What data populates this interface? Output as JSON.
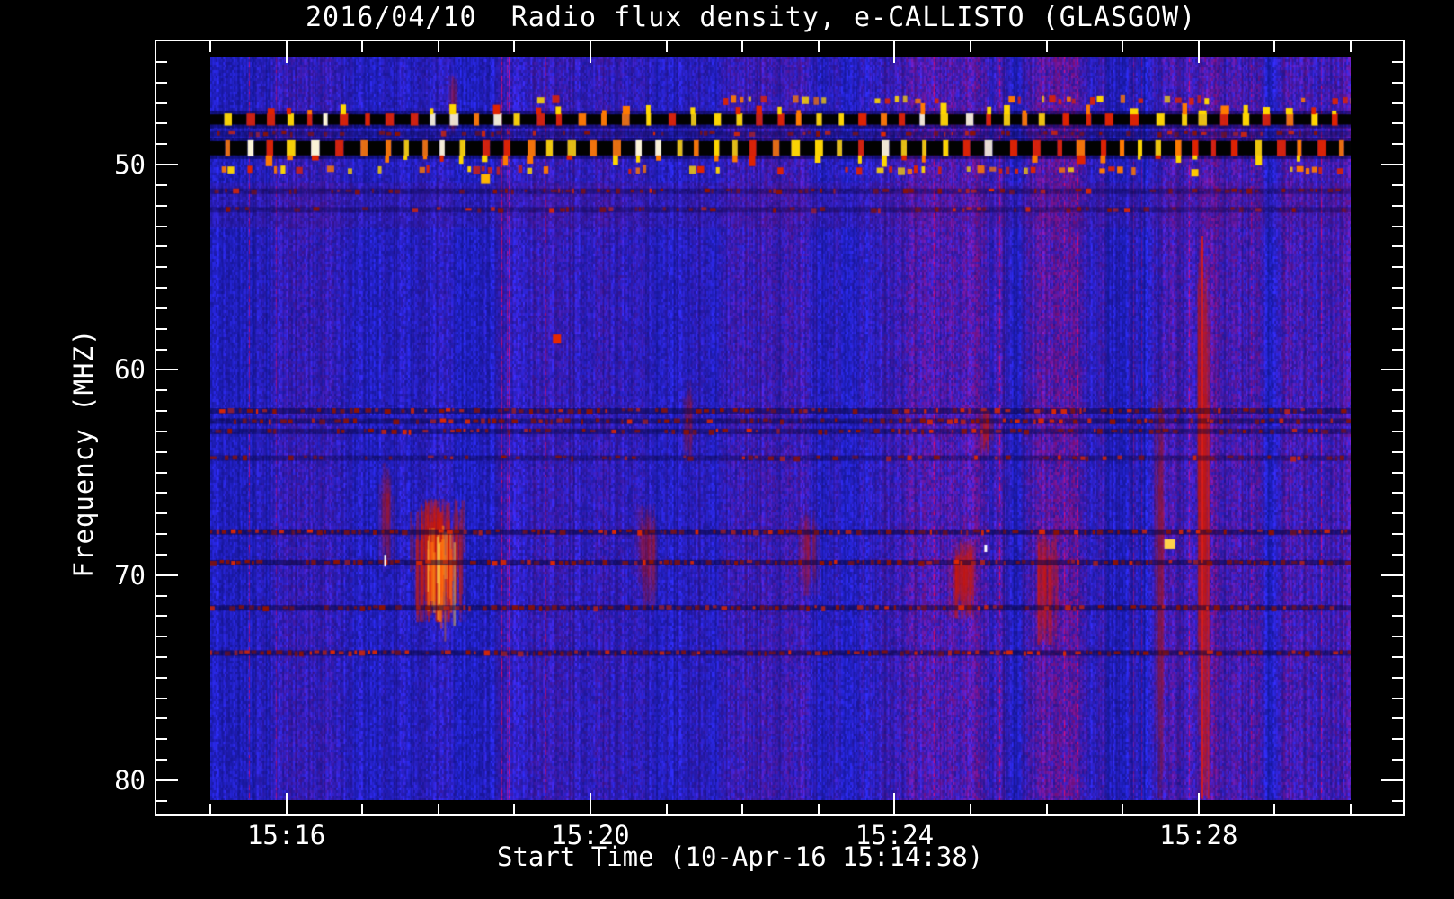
{
  "chart_data": {
    "type": "heatmap",
    "subtype": "radio-spectrogram",
    "title": "2016/04/10  Radio flux density, e-CALLISTO (GLASGOW)",
    "xlabel": "Start Time (10-Apr-16 15:14:38)",
    "ylabel": "Frequency (MHZ)",
    "date": "2016/04/10",
    "station": "GLASGOW",
    "start_time": "15:14:38",
    "x_axis": {
      "tick_labels_major": [
        "15:16",
        "15:20",
        "15:24",
        "15:28"
      ],
      "tick_minutes_major": [
        1,
        5,
        9,
        13
      ],
      "minor_step_minutes": 1,
      "data_range_minutes": [
        0,
        15
      ],
      "data_start_clock": "15:15",
      "data_end_clock": "15:30"
    },
    "y_axis": {
      "tick_labels_major": [
        "50",
        "60",
        "70",
        "80"
      ],
      "tick_mhz_major": [
        50,
        60,
        70,
        80
      ],
      "minor_step_mhz": 1,
      "data_top_mhz": 44.74,
      "data_bottom_mhz": 80.97,
      "unit": "MHZ"
    },
    "legend": "none",
    "grid": "off",
    "palette": {
      "axis_color": "#ffffff",
      "background_blue": "#1d1df0",
      "background_dark_blue": "#0d0db4",
      "noise_red": "#c81e14",
      "band_black": "#020202",
      "rfi_colors": [
        "#e02300",
        "#ff7a00",
        "#ffd700",
        "#fff8d8"
      ],
      "burst_red": "#cd1c0a",
      "burst_orange": "#ff8c14",
      "burst_hot": "#ffd250"
    },
    "rfi_bands": [
      {
        "mhz_low": 47.55,
        "mhz_high": 48.05,
        "pattern": "black-dashes-with-colored-gaps",
        "blip_side": "above"
      },
      {
        "mhz_low": 48.85,
        "mhz_high": 49.55,
        "pattern": "black-dashes-with-colored-gaps",
        "blip_side": "below"
      }
    ],
    "interference_rows": [
      {
        "mhz": 48.5,
        "strength": 0.35
      },
      {
        "mhz": 51.3,
        "strength": 0.28
      },
      {
        "mhz": 52.2,
        "strength": 0.22
      },
      {
        "mhz": 62.0,
        "strength": 0.75
      },
      {
        "mhz": 62.5,
        "strength": 0.65
      },
      {
        "mhz": 63.0,
        "strength": 0.55
      },
      {
        "mhz": 64.3,
        "strength": 0.32
      },
      {
        "mhz": 67.9,
        "strength": 0.95
      },
      {
        "mhz": 69.4,
        "strength": 0.88
      },
      {
        "mhz": 71.6,
        "strength": 0.82
      },
      {
        "mhz": 73.8,
        "strength": 0.88
      }
    ],
    "cluster_rows": [
      {
        "mhz": 46.8,
        "segments_minutes": [
          [
            4.3,
            4.65
          ],
          [
            6.75,
            8.05
          ],
          [
            8.6,
            9.65
          ],
          [
            10.5,
            12.3
          ],
          [
            12.55,
            13.15
          ],
          [
            14.35,
            15.0
          ]
        ]
      },
      {
        "mhz": 50.2,
        "segments_minutes": [
          [
            0.15,
            2.3
          ],
          [
            2.75,
            3.95
          ],
          [
            4.05,
            4.5
          ],
          [
            5.5,
            5.8
          ],
          [
            6.3,
            6.75
          ],
          [
            7.1,
            7.6
          ],
          [
            8.35,
            9.75
          ],
          [
            9.95,
            10.8
          ],
          [
            11.05,
            12.35
          ],
          [
            14.2,
            15.0
          ]
        ]
      }
    ],
    "bursts": [
      {
        "t_start": 2.6,
        "t_end": 3.4,
        "mhz_low": 66.2,
        "mhz_high": 72.3,
        "intensity": 1.0
      },
      {
        "t_start": 9.7,
        "t_end": 10.1,
        "mhz_low": 68.2,
        "mhz_high": 72.1,
        "intensity": 0.75
      },
      {
        "t_start": 10.85,
        "t_end": 11.15,
        "mhz_low": 67.7,
        "mhz_high": 73.4,
        "intensity": 0.7
      },
      {
        "t_start": 10.1,
        "t_end": 10.3,
        "mhz_low": 61.8,
        "mhz_high": 64.2,
        "intensity": 0.55
      },
      {
        "t_start": 12.95,
        "t_end": 13.15,
        "mhz_low": 53.5,
        "mhz_high": 80.9,
        "intensity": 0.7,
        "narrow": true
      },
      {
        "t_start": 12.4,
        "t_end": 12.55,
        "mhz_low": 60.0,
        "mhz_high": 80.9,
        "intensity": 0.35
      },
      {
        "t_start": 5.55,
        "t_end": 5.9,
        "mhz_low": 66.5,
        "mhz_high": 71.5,
        "intensity": 0.3
      },
      {
        "t_start": 7.7,
        "t_end": 8.0,
        "mhz_low": 66.8,
        "mhz_high": 71.0,
        "intensity": 0.3
      },
      {
        "t_start": 2.2,
        "t_end": 2.4,
        "mhz_low": 64.5,
        "mhz_high": 69.5,
        "intensity": 0.3
      },
      {
        "t_start": 6.2,
        "t_end": 6.35,
        "mhz_low": 60.5,
        "mhz_high": 64.5,
        "intensity": 0.3
      },
      {
        "t_start": 3.1,
        "t_end": 3.25,
        "mhz_low": 45.5,
        "mhz_high": 48.6,
        "intensity": 0.3
      }
    ],
    "spots": [
      {
        "t": 3.62,
        "mhz": 50.7,
        "w": 10,
        "h": 11,
        "color": "#ffb400"
      },
      {
        "t": 12.95,
        "mhz": 50.4,
        "w": 8,
        "h": 8,
        "color": "#ffc800"
      },
      {
        "t": 12.62,
        "mhz": 68.5,
        "w": 12,
        "h": 11,
        "color": "#ffd24b"
      },
      {
        "t": 4.56,
        "mhz": 58.5,
        "w": 9,
        "h": 10,
        "color": "#e62800"
      },
      {
        "t": 2.3,
        "mhz": 69.3,
        "w": 2,
        "h": 13,
        "color": "#ffffff"
      },
      {
        "t": 10.2,
        "mhz": 68.7,
        "w": 3,
        "h": 8,
        "color": "#ffffff"
      }
    ]
  }
}
